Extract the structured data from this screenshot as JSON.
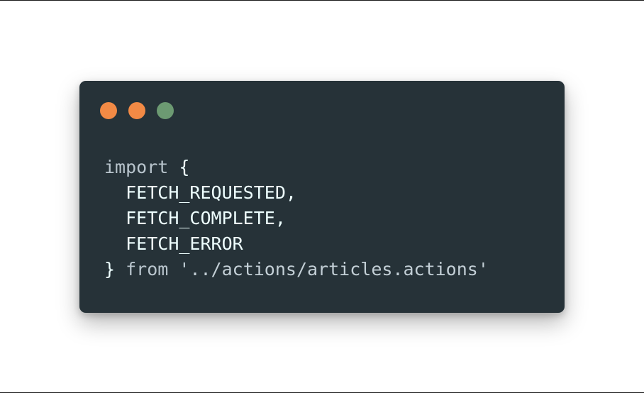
{
  "window": {
    "dots": [
      {
        "name": "dot-close",
        "color": "#f28a45"
      },
      {
        "name": "dot-minimize",
        "color": "#f28a45"
      },
      {
        "name": "dot-maximize",
        "color": "#6c9a72"
      }
    ],
    "background": "#263238"
  },
  "code": {
    "line1": {
      "keyword": "import",
      "brace": " {"
    },
    "line2": {
      "indent": "  ",
      "ident": "FETCH_REQUESTED",
      "comma": ","
    },
    "line3": {
      "indent": "  ",
      "ident": "FETCH_COMPLETE",
      "comma": ","
    },
    "line4": {
      "indent": "  ",
      "ident": "FETCH_ERROR"
    },
    "line5": {
      "brace": "} ",
      "keyword": "from",
      "space": " ",
      "string": "'../actions/articles.actions'"
    }
  }
}
